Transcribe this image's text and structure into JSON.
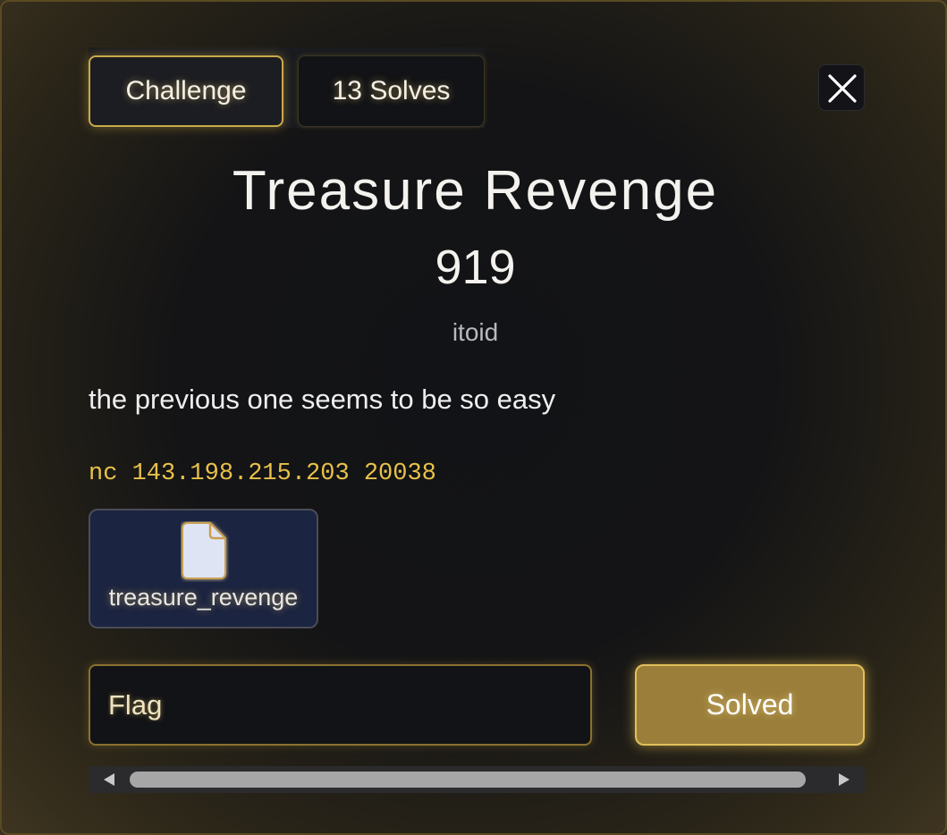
{
  "tabs": [
    {
      "label": "Challenge"
    },
    {
      "label": "13 Solves"
    }
  ],
  "challenge": {
    "name": "Treasure Revenge",
    "value": "919",
    "author": "itoid",
    "description": "the previous one seems to be so easy",
    "connection": "nc 143.198.215.203 20038"
  },
  "files": [
    {
      "name": "treasure_revenge",
      "icon": "file-icon"
    }
  ],
  "submit": {
    "placeholder": "Flag",
    "button_label": "Solved"
  },
  "icons": {
    "close": "close-icon",
    "scroll_left": "scroll-left-icon",
    "scroll_right": "scroll-right-icon"
  },
  "colors": {
    "accent": "#c9a94a",
    "connection_text": "#e8c14a",
    "solved_button": "#9a7e3a",
    "file_card": "#1b2440"
  }
}
